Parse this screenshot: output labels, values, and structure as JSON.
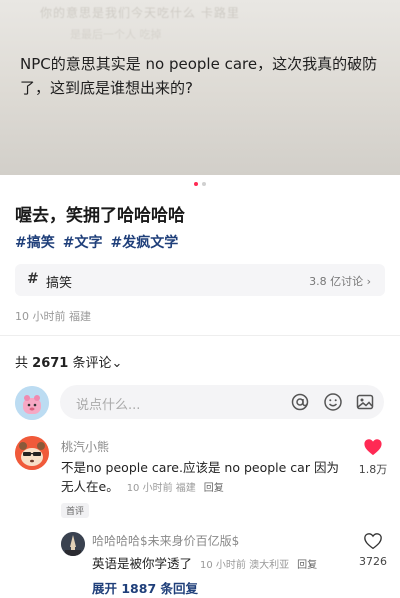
{
  "post": {
    "image_caption": "NPC的意思其实是 no people care，这次我真的破防了，这到底是谁想出来的?",
    "image_bg_text_1": "你的意思是我们今天吃什么 卡路里",
    "image_bg_text_2": "是最后一个人 吃掉",
    "carousel": {
      "count": 2,
      "active": 0
    },
    "title": "喔去，笑拥了哈哈哈哈",
    "tags": [
      "#搞笑",
      "#文字",
      "#发疯文学"
    ],
    "topic": {
      "hash": "#",
      "name": "搞笑",
      "count": "3.8 亿讨论 ›"
    },
    "meta": "10 小时前 福建"
  },
  "comments_header": {
    "prefix": "共",
    "count": "2671",
    "suffix": "条评论⌄"
  },
  "input": {
    "placeholder": "说点什么..."
  },
  "comments": [
    {
      "user": "桃汽小熊",
      "text": "不是no people care.应该是 no people car 因为无人在e。",
      "time": "10 小时前 福建",
      "reply": "回复",
      "tag": "首评",
      "likes": "1.8万",
      "liked": true,
      "replies": [
        {
          "user": "哈哈哈哈$未来身价百亿版$",
          "text": "英语是被你学透了",
          "time": "10 小时前 澳大利亚",
          "reply": "回复",
          "likes": "3726",
          "liked": false
        }
      ],
      "expand": "展开 1887 条回复"
    }
  ],
  "colors": {
    "link": "#1f3f7a",
    "like": "#ff2a54",
    "dot_active": "#ff2a54",
    "dot_inactive": "#d0d0d0"
  }
}
